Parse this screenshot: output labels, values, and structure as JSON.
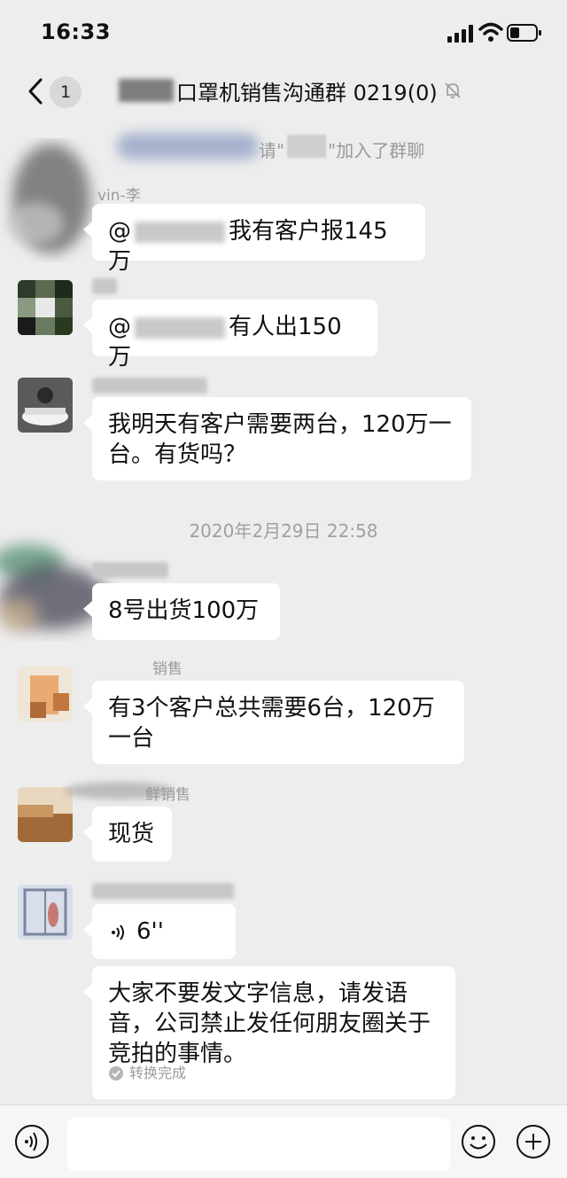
{
  "status_bar": {
    "time": "16:33"
  },
  "nav": {
    "unread_count": "1",
    "chat_title": "口罩机销售沟通群 0219(0)"
  },
  "system_notice": {
    "text_a": "请\"",
    "text_b": "\"加入了群聊"
  },
  "messages": [
    {
      "sender": "vin-李",
      "mention": "@",
      "text": "我有客户报145万"
    },
    {
      "sender": "",
      "mention": "@",
      "text": "有人出150万"
    },
    {
      "sender": "",
      "text": "我明天有客户需要两台，120万一台。有货吗？"
    }
  ],
  "timestamp": "2020年2月29日 22:58",
  "messages2": [
    {
      "sender": "",
      "text": "8号出货100万"
    },
    {
      "sender": "销售",
      "text": "有3个客户总共需要6台，120万一台"
    },
    {
      "sender": "鲜销售",
      "text": "现货"
    },
    {
      "sender": "",
      "voice_duration": "6''"
    },
    {
      "text": "大家不要发文字信息，请发语音，公司禁止发任何朋友圈关于竞拍的事情。",
      "status": "转换完成"
    }
  ],
  "icons": {
    "back": "chevron-left-icon",
    "mute": "bell-off-icon",
    "voice_toggle": "voice-icon",
    "emoji": "emoji-icon",
    "add": "plus-icon"
  },
  "colors": {
    "background": "#ededed",
    "bubble": "#ffffff",
    "meta_text": "#9a9a9a"
  }
}
